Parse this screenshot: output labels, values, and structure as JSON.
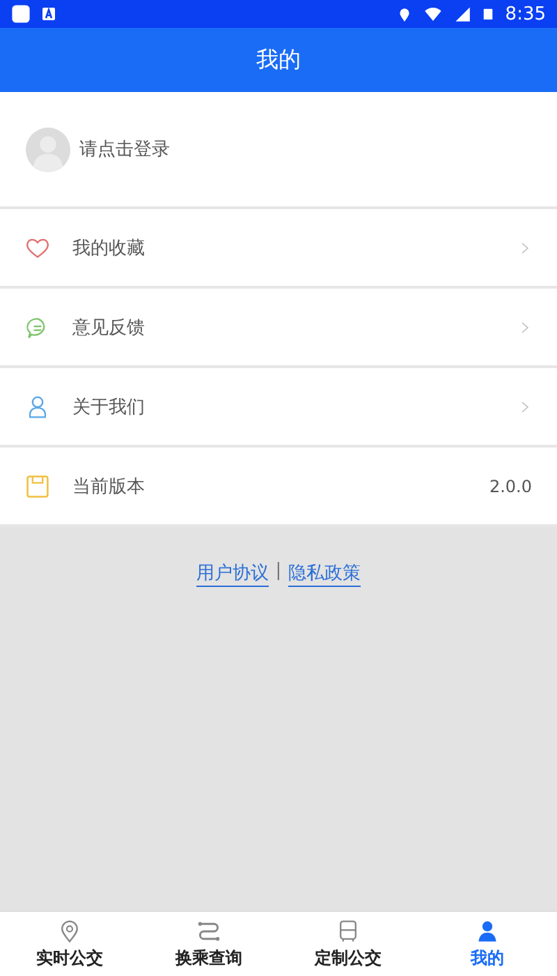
{
  "status_bar": {
    "time": "8:35"
  },
  "header": {
    "title": "我的"
  },
  "login": {
    "label": "请点击登录"
  },
  "menu": [
    {
      "label": "我的收藏",
      "kind": "link"
    },
    {
      "label": "意见反馈",
      "kind": "link"
    },
    {
      "label": "关于我们",
      "kind": "link"
    },
    {
      "label": "当前版本",
      "kind": "value",
      "value": "2.0.0"
    }
  ],
  "footer_links": {
    "first": "用户协议",
    "separator": "|",
    "second": "隐私政策"
  },
  "tabs": [
    {
      "label": "实时公交",
      "selected": false
    },
    {
      "label": "换乘查询",
      "selected": false
    },
    {
      "label": "定制公交",
      "selected": false
    },
    {
      "label": "我的",
      "selected": true
    }
  ]
}
